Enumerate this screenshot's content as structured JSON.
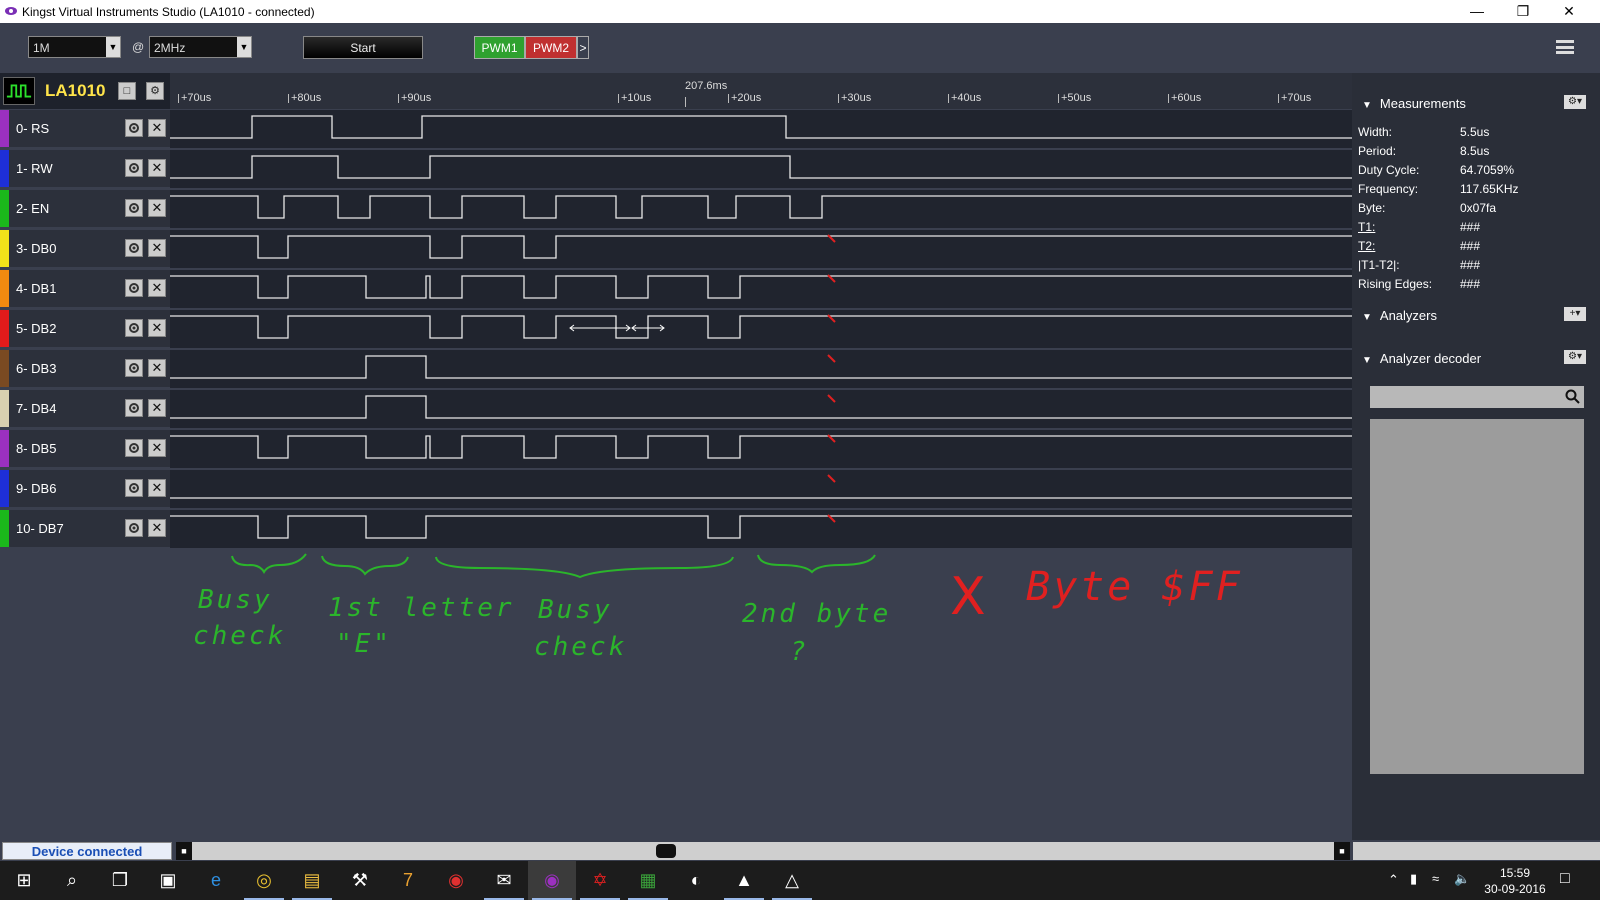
{
  "window": {
    "title": "Kingst Virtual Instruments Studio (LA1010 - connected)",
    "min_icon": "minimize-icon",
    "max_icon": "restore-icon",
    "close_icon": "close-icon"
  },
  "toolbar": {
    "sample_depth": "1M",
    "at_label": "@",
    "sample_rate": "2MHz",
    "start_label": "Start",
    "pwm1_label": "PWM1",
    "pwm1_color": "#2fa12f",
    "pwm2_label": "PWM2",
    "pwm2_color": "#c03030",
    "more_label": ">",
    "menu_icon": "hamburger-menu-icon"
  },
  "device": {
    "name": "LA1010",
    "name_color": "#ffe44a"
  },
  "ruler": {
    "cursor_time": "207.6ms",
    "ticks": [
      "+70us",
      "+80us",
      "+90us",
      "+10us",
      "+20us",
      "+30us",
      "+40us",
      "+50us",
      "+60us",
      "+70us"
    ]
  },
  "channels": [
    {
      "label": "0-  RS",
      "color": "#9b30c0"
    },
    {
      "label": "1-  RW",
      "color": "#1e2fd8"
    },
    {
      "label": "2-  EN",
      "color": "#1bb81b"
    },
    {
      "label": "3-  DB0",
      "color": "#f2e21a"
    },
    {
      "label": "4-  DB1",
      "color": "#f08a10"
    },
    {
      "label": "5-  DB2",
      "color": "#e21b1b"
    },
    {
      "label": "6-  DB3",
      "color": "#7a4a22"
    },
    {
      "label": "7-  DB4",
      "color": "#d8d0b0"
    },
    {
      "label": "8-  DB5",
      "color": "#9b30c0"
    },
    {
      "label": "9-  DB6",
      "color": "#1e2fd8"
    },
    {
      "label": "10- DB7",
      "color": "#1bb81b"
    }
  ],
  "measurements": {
    "title": "Measurements",
    "rows": [
      {
        "key": "Width:",
        "value": "5.5us"
      },
      {
        "key": "Period:",
        "value": "8.5us"
      },
      {
        "key": "Duty Cycle:",
        "value": "64.7059%"
      },
      {
        "key": "Frequency:",
        "value": "117.65KHz"
      },
      {
        "key": "Byte:",
        "value": "0x07fa"
      },
      {
        "key": "T1:",
        "value": "###"
      },
      {
        "key": "T2:",
        "value": "###"
      },
      {
        "key": "|T1-T2|:",
        "value": "###"
      },
      {
        "key": "Rising Edges:",
        "value": "###"
      }
    ]
  },
  "analyzers": {
    "title": "Analyzers",
    "add_label": "+"
  },
  "analyzer_decoder": {
    "title": "Analyzer decoder",
    "search_placeholder": ""
  },
  "status": {
    "device_status": "Device connected"
  },
  "annotations": {
    "busy_check_1": [
      "Busy",
      "check"
    ],
    "first_letter": [
      "1st letter",
      "\"E\""
    ],
    "busy_check_2": [
      "Busy",
      "check"
    ],
    "second_byte": [
      "2nd byte",
      "?"
    ],
    "cross": "X",
    "byte_ff": "Byte $FF",
    "green": "#2bb52b",
    "red": "#e02020"
  },
  "taskbar": {
    "apps": [
      "windows-start-icon",
      "search-icon",
      "task-view-icon",
      "store-icon",
      "edge-icon",
      "chrome-icon",
      "file-explorer-icon",
      "tools-icon",
      "7zip-icon",
      "app-icon",
      "mail-icon",
      "kingst-icon",
      "acrobat-icon",
      "avr-icon",
      "paint-icon",
      "photos-icon",
      "app-icon-2"
    ],
    "time": "15:59",
    "date": "30-09-2016"
  }
}
